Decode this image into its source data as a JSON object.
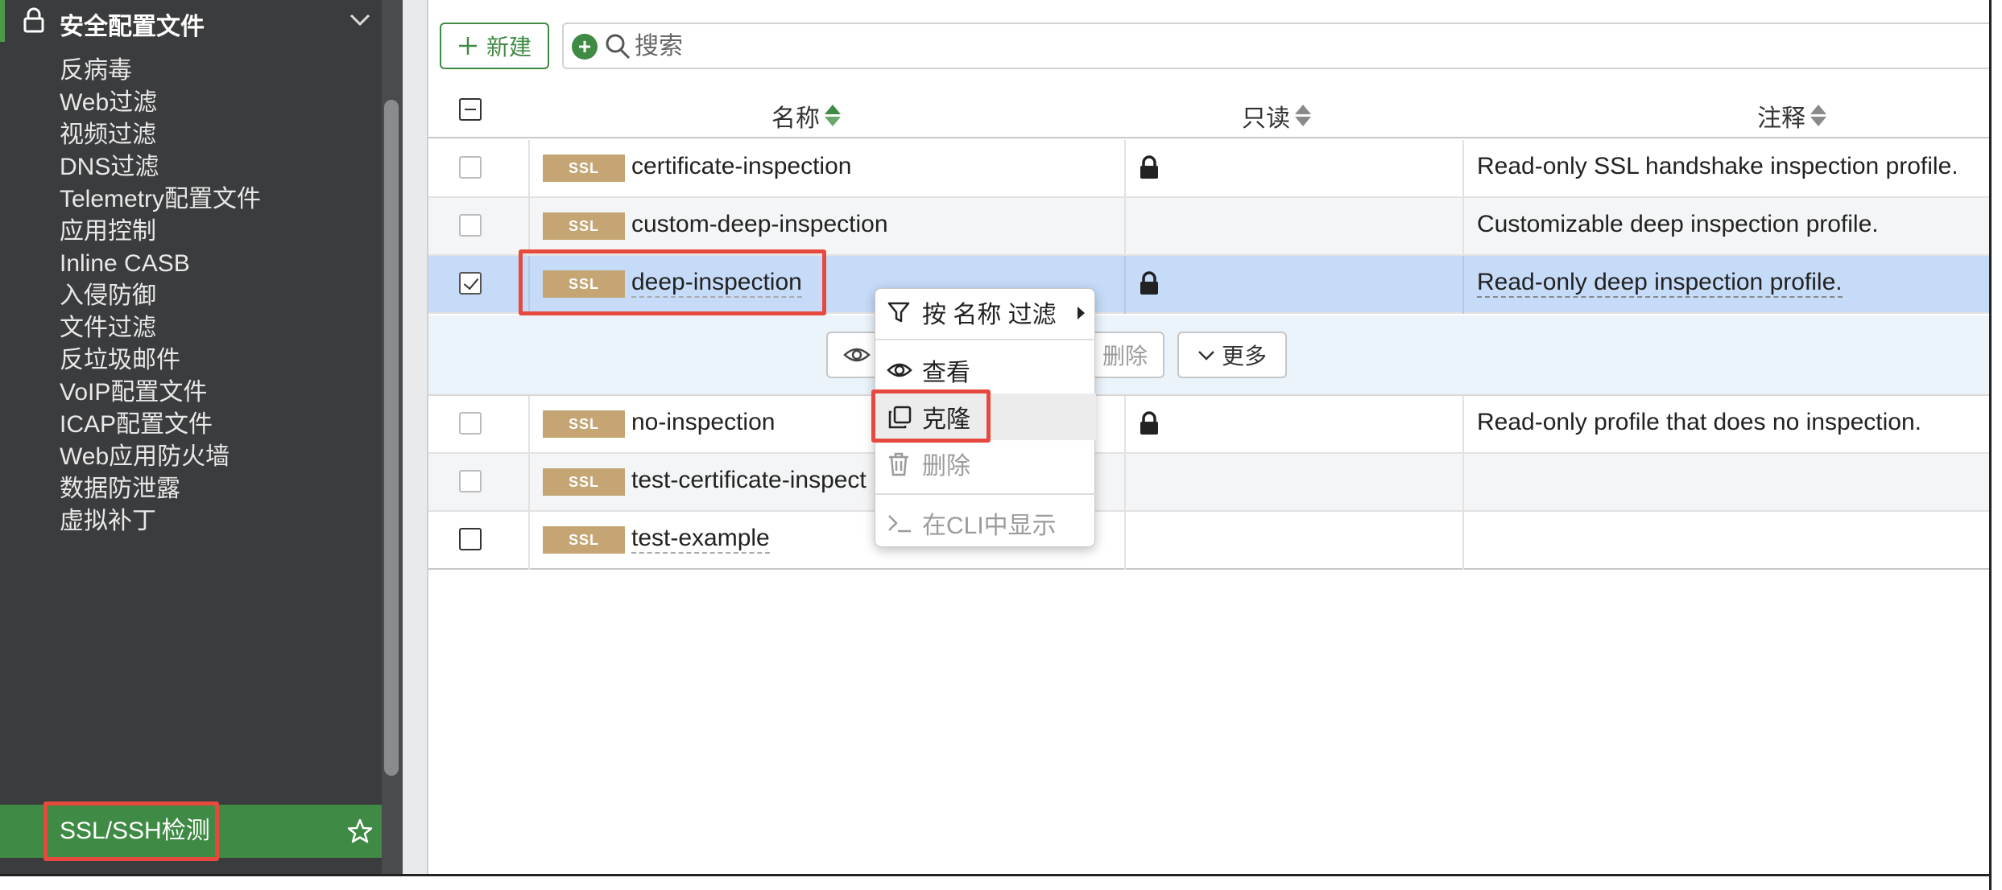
{
  "sidebar": {
    "header": "安全配置文件",
    "items": [
      "反病毒",
      "Web过滤",
      "视频过滤",
      "DNS过滤",
      "Telemetry配置文件",
      "应用控制",
      "Inline CASB",
      "入侵防御",
      "文件过滤",
      "反垃圾邮件",
      "VoIP配置文件",
      "ICAP配置文件",
      "Web应用防火墙",
      "数据防泄露",
      "虚拟补丁",
      "SSL/SSH检测"
    ],
    "active_index": 15
  },
  "toolbar": {
    "new_label": "新建",
    "search_placeholder": "搜索"
  },
  "table": {
    "columns": [
      "名称",
      "只读",
      "注释"
    ],
    "badge": "SSL",
    "rows": [
      {
        "name": "certificate-inspection",
        "readonly": true,
        "comment": "Read-only SSL handshake inspection profile."
      },
      {
        "name": "custom-deep-inspection",
        "readonly": false,
        "comment": "Customizable deep inspection profile."
      },
      {
        "name": "deep-inspection",
        "readonly": true,
        "comment": "Read-only deep inspection profile."
      },
      {
        "name": "no-inspection",
        "readonly": true,
        "comment": "Read-only profile that does no inspection."
      },
      {
        "name": "test-certificate-inspect",
        "readonly": false,
        "comment": ""
      },
      {
        "name": "test-example",
        "readonly": false,
        "comment": ""
      }
    ]
  },
  "action_bar": {
    "delete_label": "删除",
    "more_label": "更多"
  },
  "context_menu": {
    "filter_by_name": "按 名称 过滤",
    "view": "查看",
    "clone": "克隆",
    "delete": "删除",
    "show_cli": "在CLI中显示"
  },
  "colors": {
    "sidebar_bg": "#3b3c3e",
    "active_green": "#3f8a44",
    "selected_row": "#c5dbf8",
    "badge": "#c4a573",
    "highlight_red": "#e64a3e"
  }
}
